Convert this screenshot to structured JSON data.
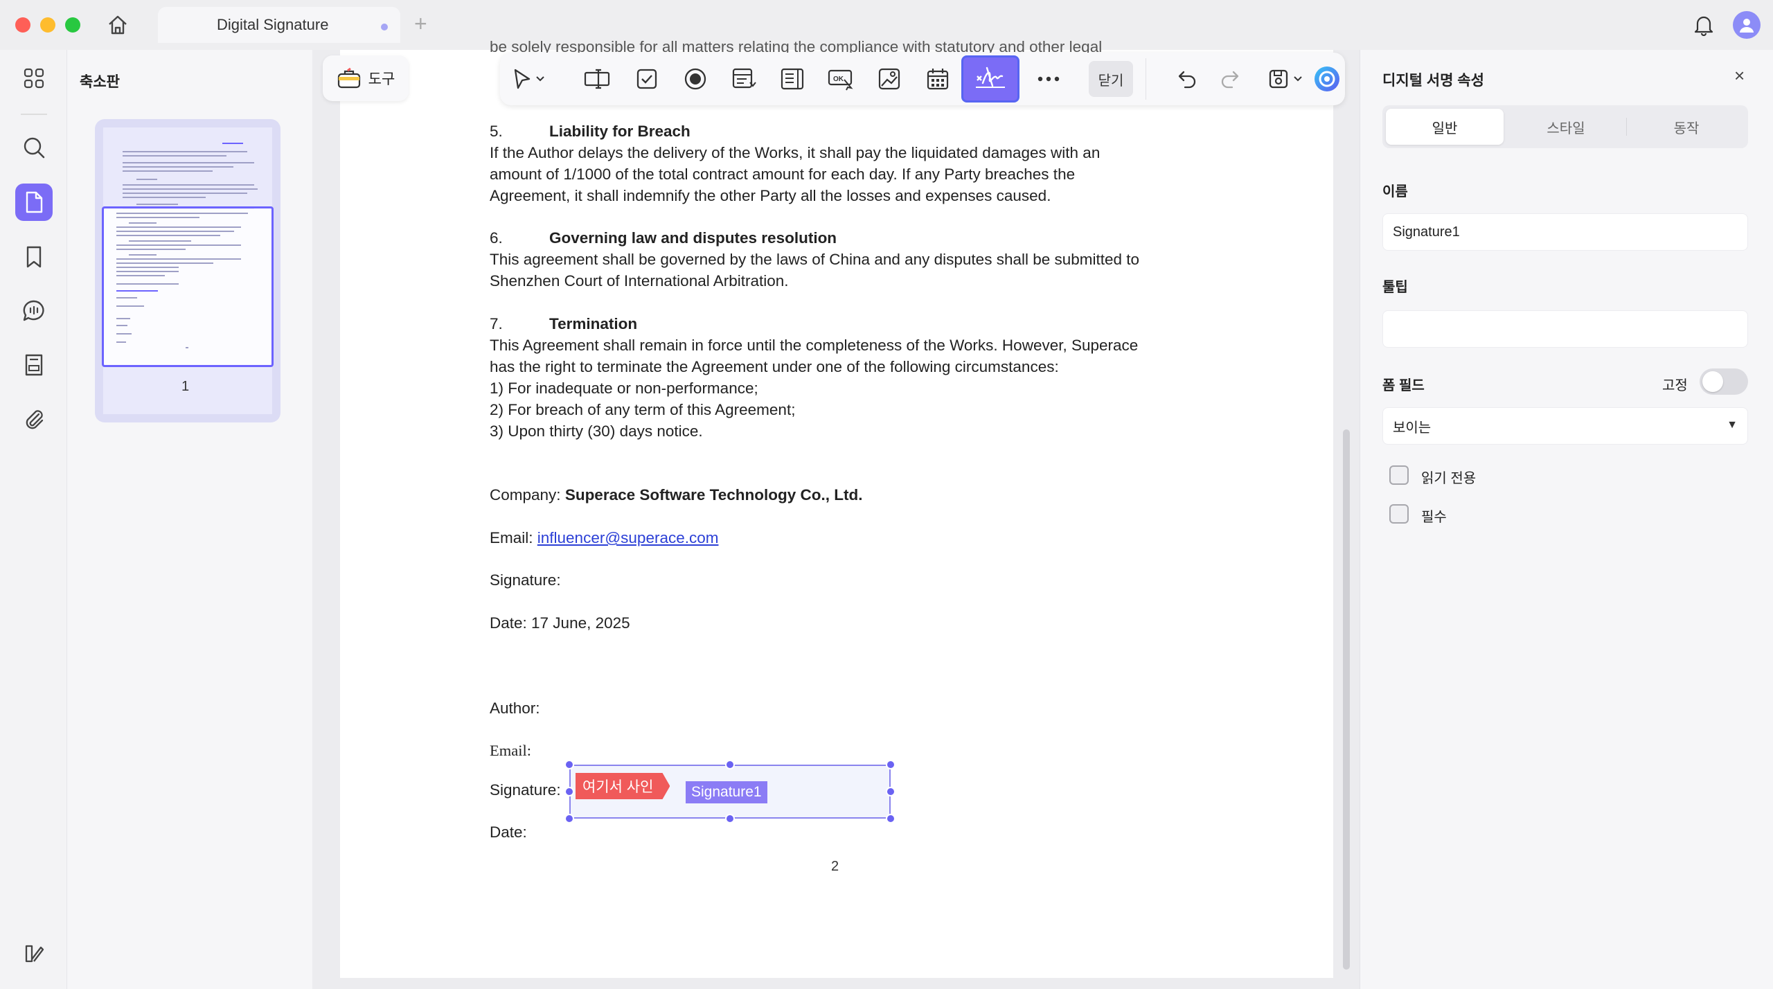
{
  "window": {
    "tab_title": "Digital Signature",
    "tab_add": "+"
  },
  "thumbnails": {
    "title": "축소판",
    "page_number": "1"
  },
  "toolbar": {
    "tools_label": "도구",
    "close_label": "닫기"
  },
  "document": {
    "cut_top": "be solely responsible for all matters relating the compliance with statutory and other legal",
    "sections": [
      {
        "num": "5.",
        "title": "Liability for Breach",
        "lines": [
          "If the Author delays the delivery of the Works, it shall pay the liquidated damages with an",
          "amount of 1/1000 of the total contract amount for each day. If any Party breaches the",
          "Agreement, it shall indemnify the other Party all the losses and expenses caused."
        ]
      },
      {
        "num": "6.",
        "title": "Governing law and disputes resolution",
        "lines": [
          "This agreement shall be governed by the laws of China and any disputes shall be submitted to",
          "Shenzhen Court of International Arbitration."
        ]
      },
      {
        "num": "7.",
        "title": "Termination",
        "lines": [
          "This Agreement shall remain in force until the completeness of the Works. However, Superace",
          "has the right to terminate the Agreement under one of the following circumstances:",
          "1) For inadequate or non-performance;",
          "2) For breach of any term of this Agreement;",
          "3)  Upon thirty (30) days notice."
        ]
      }
    ],
    "company_label": "Company: ",
    "company_value": "Superace Software Technology Co., Ltd.",
    "email_label": "Email: ",
    "email_value": "influencer@superace.com",
    "signature_label": "Signature:",
    "date_label": "Date: 17 June, 2025",
    "author_label": "Author:",
    "author_email_label": "Email:",
    "author_signature_label": "Signature:",
    "author_date_label": "Date:",
    "page_number": "2"
  },
  "signature_field": {
    "sign_here": "여기서 사인",
    "name": "Signature1"
  },
  "properties": {
    "title": "디지털 서명 속성",
    "close": "×",
    "tabs": [
      "일반",
      "스타일",
      "동작"
    ],
    "name_label": "이름",
    "name_value": "Signature1",
    "tooltip_label": "툴팁",
    "tooltip_value": "",
    "form_field_label": "폼 필드",
    "lock_label": "고정",
    "visibility_value": "보이는",
    "readonly_label": "읽기 전용",
    "required_label": "필수"
  },
  "colors": {
    "accent": "#7b6cf6",
    "sign_here": "#f05a5a"
  }
}
